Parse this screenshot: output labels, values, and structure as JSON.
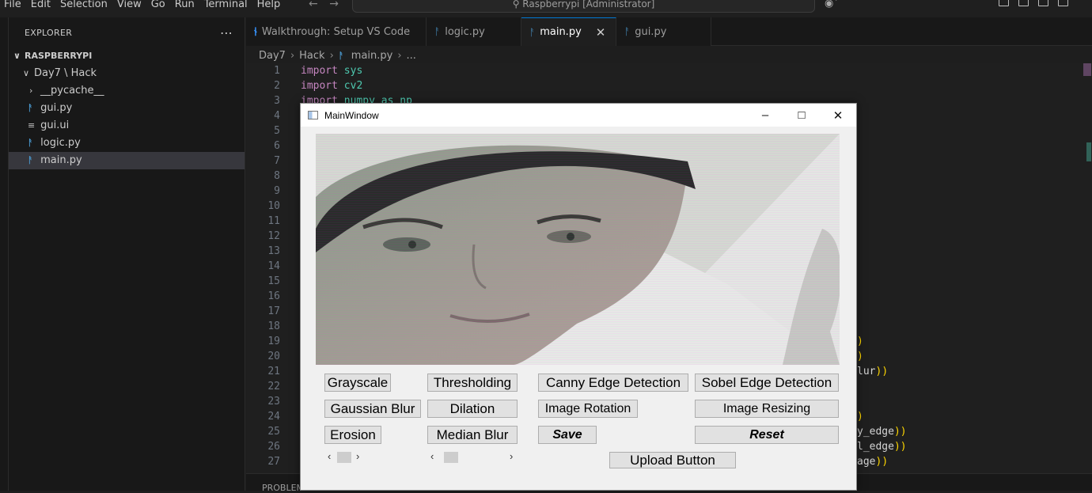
{
  "menubar": {
    "items": [
      "File",
      "Edit",
      "Selection",
      "View",
      "Go",
      "Run",
      "Terminal",
      "Help"
    ],
    "command_center": "Raspberrypi [Administrator]"
  },
  "sidebar": {
    "title": "EXPLORER",
    "root": "RASPBERRYPI",
    "folder": "Day7 \\ Hack",
    "items": [
      {
        "label": "__pycache__",
        "type": "folder"
      },
      {
        "label": "gui.py",
        "type": "py"
      },
      {
        "label": "gui.ui",
        "type": "ui"
      },
      {
        "label": "logic.py",
        "type": "py"
      },
      {
        "label": "main.py",
        "type": "py"
      }
    ]
  },
  "tabs": [
    {
      "label": "Walkthrough: Setup VS Code",
      "icon": "vscode-icon"
    },
    {
      "label": "logic.py",
      "icon": "python-icon"
    },
    {
      "label": "main.py",
      "icon": "python-icon",
      "active": true
    },
    {
      "label": "gui.py",
      "icon": "python-icon"
    }
  ],
  "breadcrumb": [
    "Day7",
    "Hack",
    "main.py",
    "..."
  ],
  "editor": {
    "line_numbers": [
      "1",
      "2",
      "3",
      "4",
      "5",
      "6",
      "7",
      "8",
      "9",
      "10",
      "11",
      "12",
      "13",
      "14",
      "15",
      "16",
      "17",
      "18",
      "19",
      "20",
      "21",
      "22",
      "23",
      "24",
      "25",
      "26",
      "27"
    ],
    "code": [
      {
        "kw": "import",
        "mod": "sys"
      },
      {
        "kw": "import",
        "mod": "cv2"
      },
      {
        "kw": "import",
        "mod": "numpy as np"
      }
    ],
    "right_fragments": [
      {
        "line": 19,
        "text": ")"
      },
      {
        "line": 20,
        "text": ")"
      },
      {
        "line": 21,
        "text": "lur))"
      },
      {
        "line": 24,
        "text": ")"
      },
      {
        "line": 25,
        "text": "y_edge))"
      },
      {
        "line": 26,
        "text": "l_edge))"
      },
      {
        "line": 27,
        "text": "age))"
      }
    ]
  },
  "panel": {
    "label": "PROBLEMS"
  },
  "qt_window": {
    "title": "MainWindow",
    "buttons": {
      "grayscale": "Grayscale",
      "thresholding": "Thresholding",
      "canny": "Canny Edge Detection",
      "sobel": "Sobel Edge Detection",
      "gaussian": "Gaussian Blur",
      "dilation": "Dilation",
      "rotation": "Image Rotation",
      "resizing": "Image Resizing",
      "erosion": "Erosion",
      "median": "Median Blur",
      "save": "Save",
      "reset": "Reset",
      "upload": "Upload Button"
    },
    "sliders": [
      {
        "value": 0.1
      },
      {
        "value": 0.15
      }
    ]
  }
}
